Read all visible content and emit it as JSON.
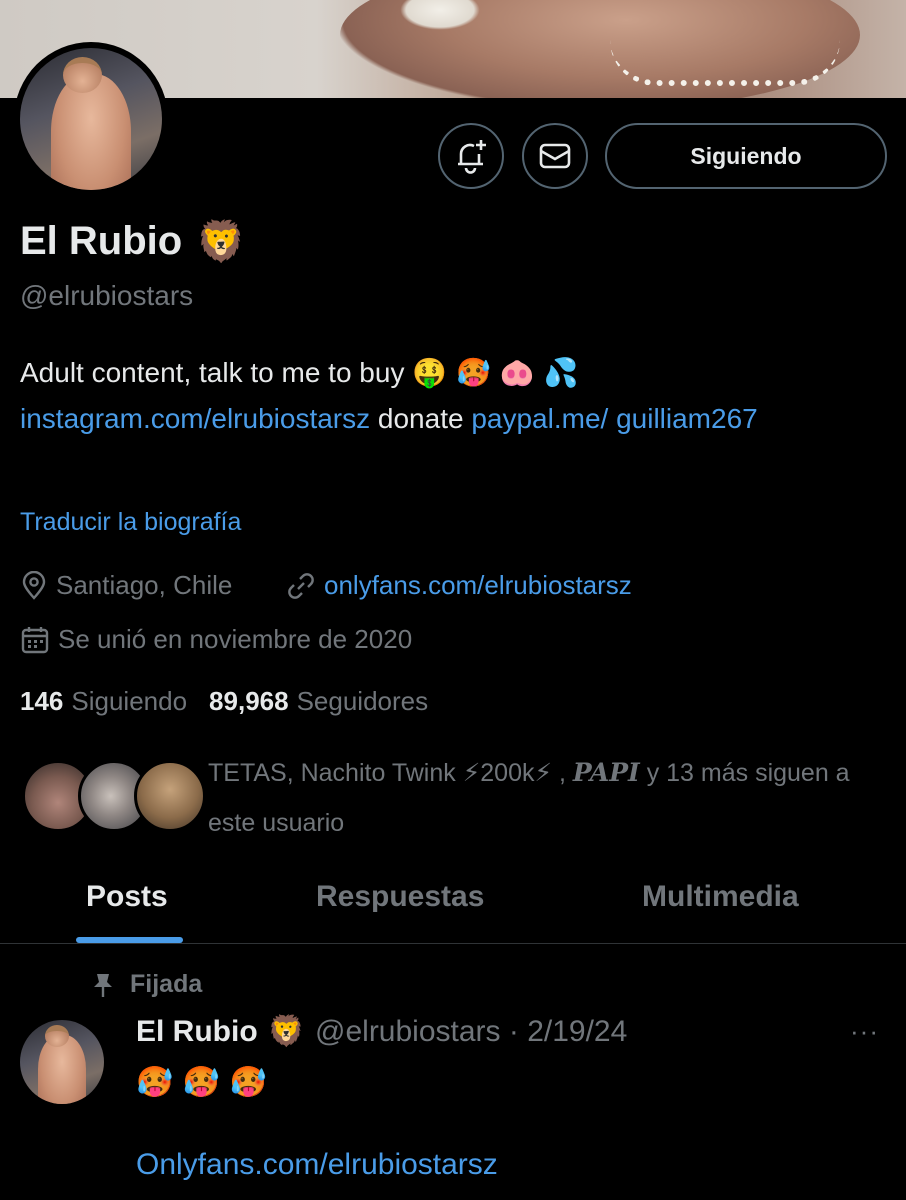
{
  "profile": {
    "name": "El Rubio",
    "name_emoji": "🦁",
    "handle": "@elrubiostars",
    "bio_text": "Adult content, talk to me to buy ",
    "bio_emojis": "🤑 🥵 🐽 💦",
    "bio_link_instagram": "instagram.com/elrubiostarsz",
    "bio_donate": " donate ",
    "bio_link_paypal": "paypal.me/ guilliam267",
    "translate_label": "Traducir la biografía",
    "location": "Santiago, Chile",
    "website": "onlyfans.com/elrubiostarsz",
    "joined": "Se unió en noviembre de 2020",
    "following_count": "146",
    "following_label": "Siguiendo",
    "followers_count": "89,968",
    "followers_label": "Seguidores",
    "followed_by_names": "TETAS, Nachito Twink ⚡200k⚡ , ",
    "followed_by_papi": "PAPI",
    "followed_by_rest": " y 13 más siguen a este usuario"
  },
  "actions": {
    "notify_icon": "bell-plus-icon",
    "message_icon": "envelope-icon",
    "follow_label": "Siguiendo"
  },
  "tabs": [
    {
      "label": "Posts",
      "active": true
    },
    {
      "label": "Respuestas",
      "active": false
    },
    {
      "label": "Multimedia",
      "active": false
    }
  ],
  "pinned_tweet": {
    "pinned_label": "Fijada",
    "author_name": "El Rubio",
    "author_emoji": "🦁",
    "author_handle_date": "@elrubiostars · 2/19/24",
    "more_label": "···",
    "emojis": "🥵 🥵 🥵",
    "link": "Onlyfans.com/elrubiostarsz"
  },
  "colors": {
    "accent": "#4a9ce8",
    "muted": "#71767b",
    "border": "#536471"
  }
}
